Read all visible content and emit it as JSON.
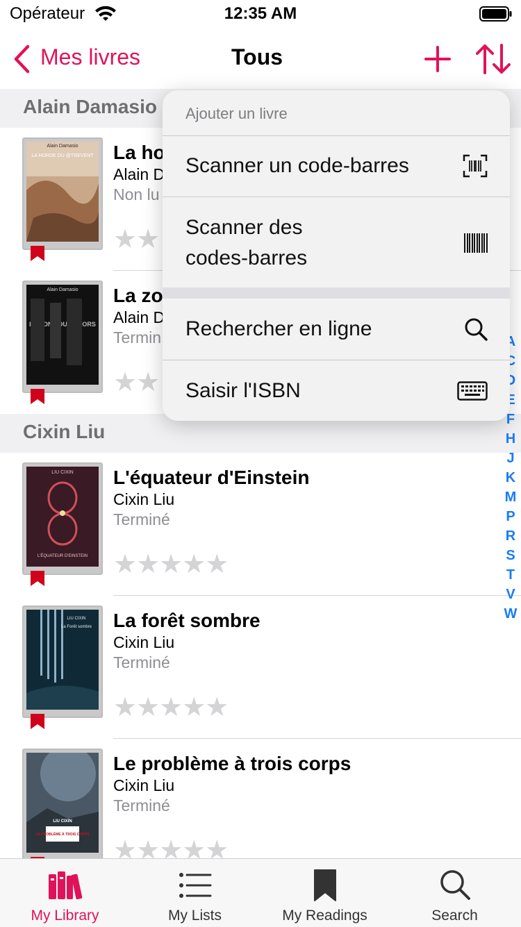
{
  "status_bar": {
    "carrier": "Opérateur",
    "time": "12:35 AM"
  },
  "nav": {
    "back_label": "Mes livres",
    "title": "Tous"
  },
  "accent_color": "#e0135a",
  "index_color": "#1a7cf5",
  "sections": [
    {
      "header": "Alain Damasio",
      "books": [
        {
          "title": "La ho",
          "author": "Alain D",
          "status": "Non lu",
          "stars": "★★"
        },
        {
          "title": "La zo",
          "author": "Alain D",
          "status": "Termin",
          "stars": "★★"
        }
      ]
    },
    {
      "header": "Cixin Liu",
      "books": [
        {
          "title": "L'équateur d'Einstein",
          "author": "Cixin Liu",
          "status": "Terminé",
          "stars": "★★★★★"
        },
        {
          "title": "La forêt sombre",
          "author": "Cixin Liu",
          "status": "Terminé",
          "stars": "★★★★★"
        },
        {
          "title": "Le problème à trois corps",
          "author": "Cixin Liu",
          "status": "Terminé",
          "stars": "★★★★★"
        }
      ]
    }
  ],
  "covers": {
    "c1": {
      "text_top": "Alain Damasio",
      "text_main": "LA HORDE DU @TREVENT"
    },
    "c2": {
      "text_top": "Alain Damasio",
      "text_main": "LA ZONE DU DEHORS"
    },
    "c3": {
      "text_top": "LIU CIXIN",
      "text_main": "L'ÉQUATEUR D'EINSTEIN"
    },
    "c4": {
      "text_top": "LIU CIXIN",
      "text_main": "La Forêt sombre"
    },
    "c5": {
      "text_top": "LIU CIXIN",
      "text_main": "LE PROBLÈME À TROIS CORPS"
    }
  },
  "index_letters": [
    "A",
    "C",
    "D",
    "E",
    "F",
    "H",
    "J",
    "K",
    "M",
    "P",
    "R",
    "S",
    "T",
    "V",
    "W"
  ],
  "menu": {
    "header": "Ajouter un livre",
    "items": [
      {
        "label": "Scanner un code-barres",
        "icon": "barcode-scan-icon"
      },
      {
        "label": "Scanner des codes-barres",
        "label_line1": "Scanner des",
        "label_line2": "codes-barres",
        "icon": "barcode-icon"
      },
      {
        "label": "Rechercher en ligne",
        "icon": "search-icon"
      },
      {
        "label": "Saisir l'ISBN",
        "icon": "keyboard-icon"
      }
    ]
  },
  "tabs": [
    {
      "label": "My Library",
      "icon": "library-icon",
      "active": true
    },
    {
      "label": "My Lists",
      "icon": "list-icon",
      "active": false
    },
    {
      "label": "My Readings",
      "icon": "bookmark-icon",
      "active": false
    },
    {
      "label": "Search",
      "icon": "search-icon",
      "active": false
    }
  ]
}
